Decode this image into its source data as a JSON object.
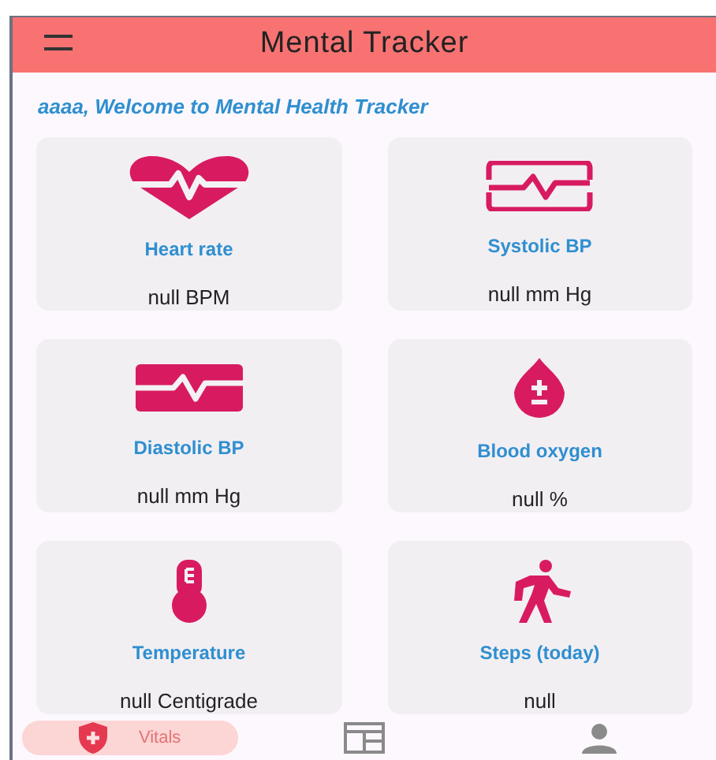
{
  "app_bar": {
    "title": "Mental Tracker"
  },
  "welcome": "aaaa, Welcome to Mental Health Tracker",
  "cards": [
    {
      "kind": "heart",
      "label": "Heart rate",
      "value": "null BPM"
    },
    {
      "kind": "systolic",
      "label": "Systolic BP",
      "value": "null mm Hg"
    },
    {
      "kind": "diastolic",
      "label": "Diastolic BP",
      "value": "null mm Hg"
    },
    {
      "kind": "oxygen",
      "label": "Blood oxygen",
      "value": "null %"
    },
    {
      "kind": "temperature",
      "label": "Temperature",
      "value": "null Centigrade"
    },
    {
      "kind": "steps",
      "label": "Steps (today)",
      "value": "null"
    }
  ],
  "bottom_nav": [
    {
      "kind": "vitals",
      "label": "Vitals",
      "selected": true
    },
    {
      "kind": "calendar",
      "selected": false
    },
    {
      "kind": "person",
      "selected": false
    }
  ]
}
